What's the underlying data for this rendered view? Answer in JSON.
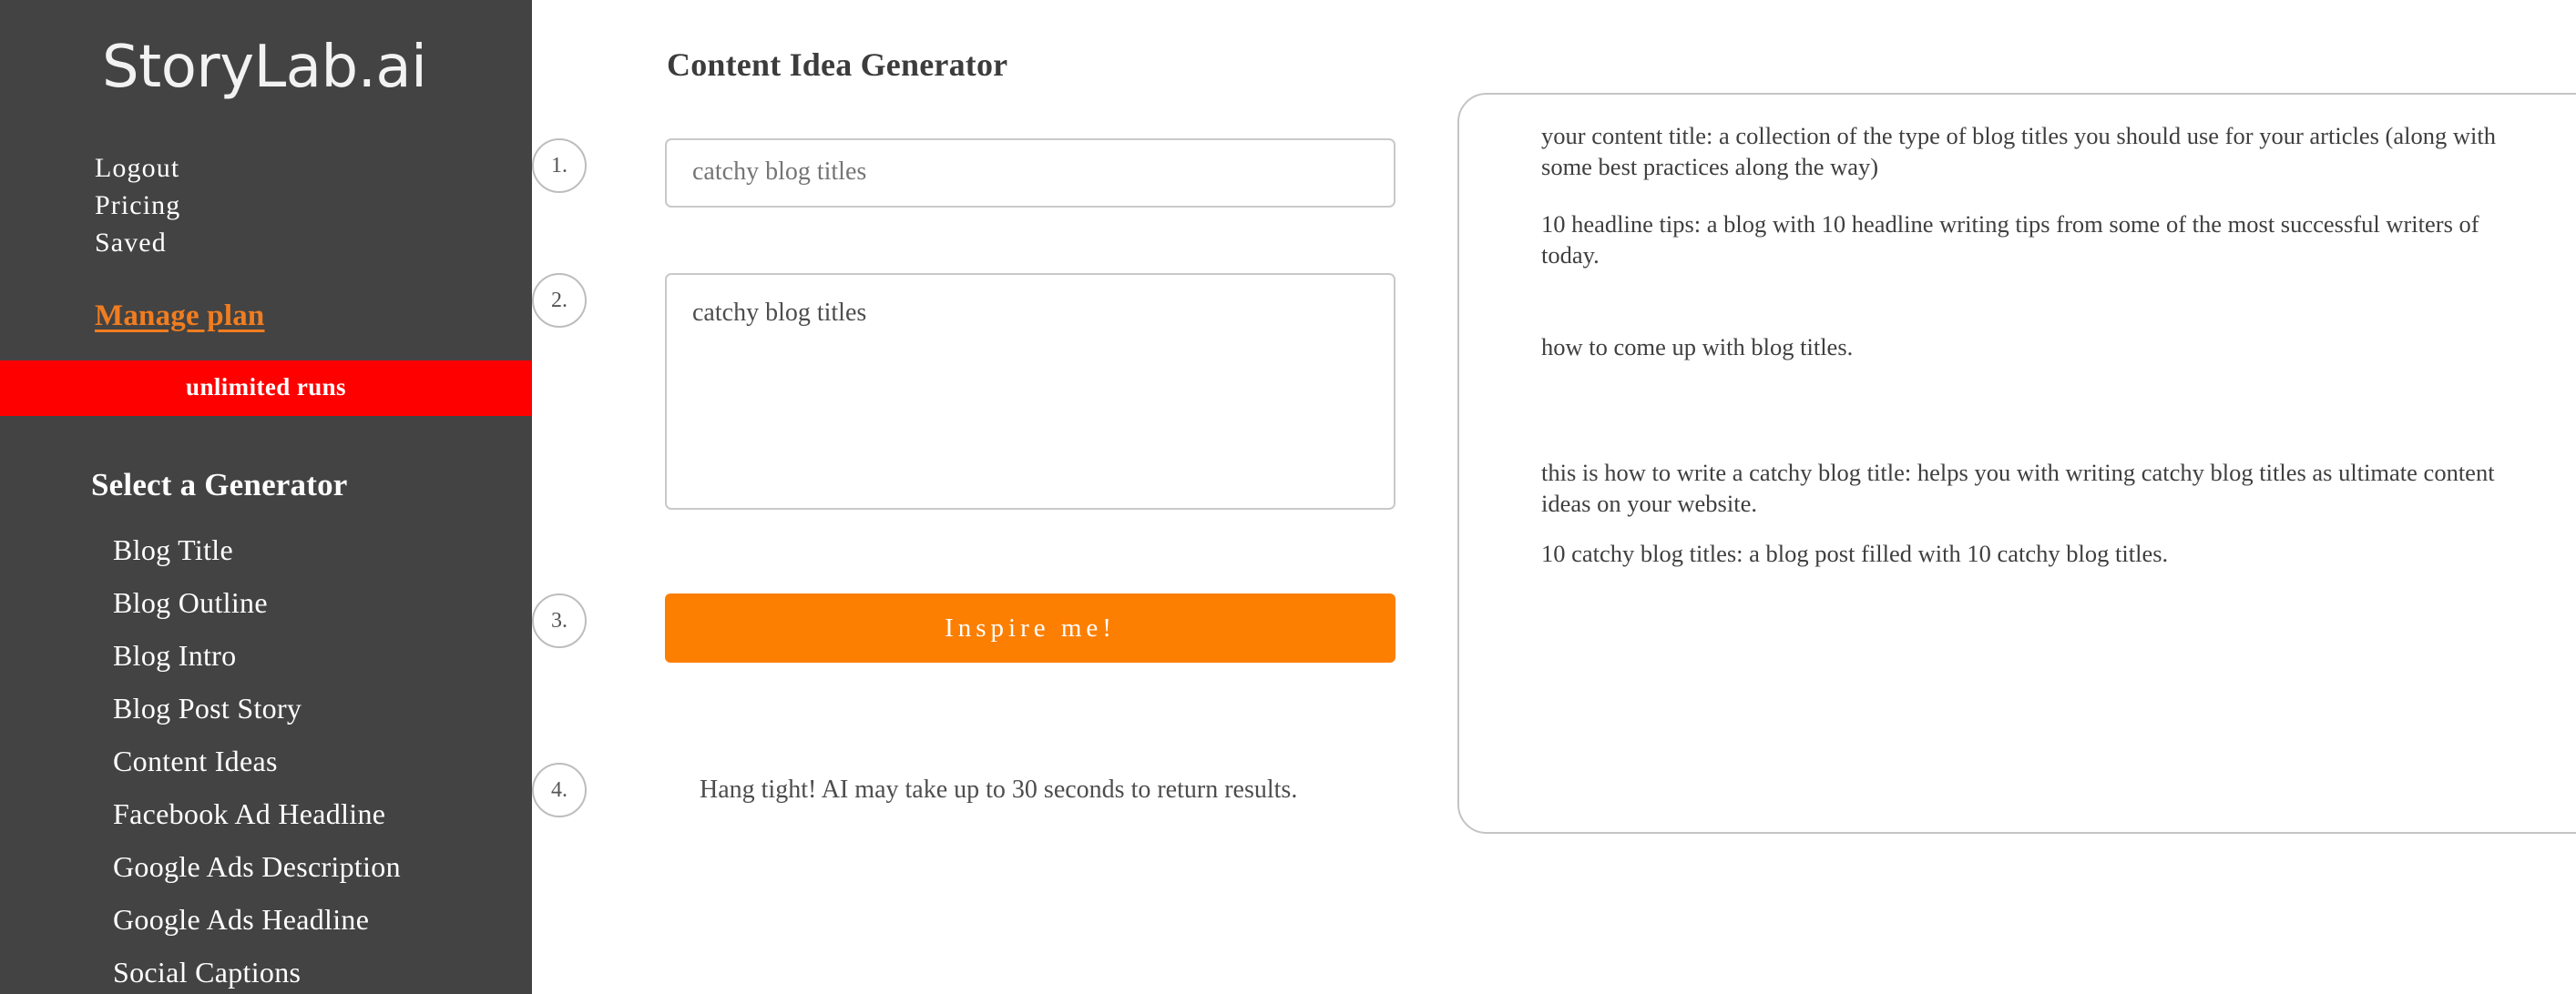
{
  "sidebar": {
    "brand": "StoryLab.ai",
    "account_links": [
      {
        "label": "Logout"
      },
      {
        "label": "Pricing"
      },
      {
        "label": "Saved"
      }
    ],
    "manage_plan_label": "Manage plan",
    "runs_banner_label": "unlimited runs",
    "generator_heading": "Select a Generator",
    "generators": [
      {
        "label": "Blog Title"
      },
      {
        "label": "Blog Outline"
      },
      {
        "label": "Blog Intro"
      },
      {
        "label": "Blog Post Story"
      },
      {
        "label": "Content Ideas"
      },
      {
        "label": "Facebook Ad Headline"
      },
      {
        "label": "Google Ads Description"
      },
      {
        "label": "Google Ads Headline"
      },
      {
        "label": "Social Captions"
      }
    ],
    "colors": {
      "background": "#434343",
      "manage_plan": "#f07d20",
      "runs_banner": "#fe0000"
    }
  },
  "main": {
    "page_title": "Content Idea Generator",
    "steps": {
      "one": "1.",
      "two": "2.",
      "three": "3.",
      "four": "4."
    },
    "keyword_input": {
      "value": "",
      "placeholder": "catchy blog titles"
    },
    "description_textarea": {
      "value": "catchy blog titles",
      "placeholder": "catchy blog titles"
    },
    "inspire_button_label": "Inspire me!",
    "inspire_button_color": "#fc7f02",
    "status_message": "Hang tight! AI may take up to 30 seconds to return results."
  },
  "results": {
    "delete_icon": "✖",
    "items": [
      {
        "text": " your content title: a collection of the type of blog titles you should use for your articles (along with some best practices along the way)"
      },
      {
        "text": "10 headline tips: a blog with 10 headline writing tips from some of the most successful writers of today."
      },
      {
        "text": " how to come up with blog titles."
      },
      {
        "text": " this is how to write a catchy blog title: helps you with writing catchy blog titles as ultimate content ideas on your website."
      },
      {
        "text": "10 catchy blog titles: a blog post filled with 10 catchy blog titles."
      }
    ]
  }
}
